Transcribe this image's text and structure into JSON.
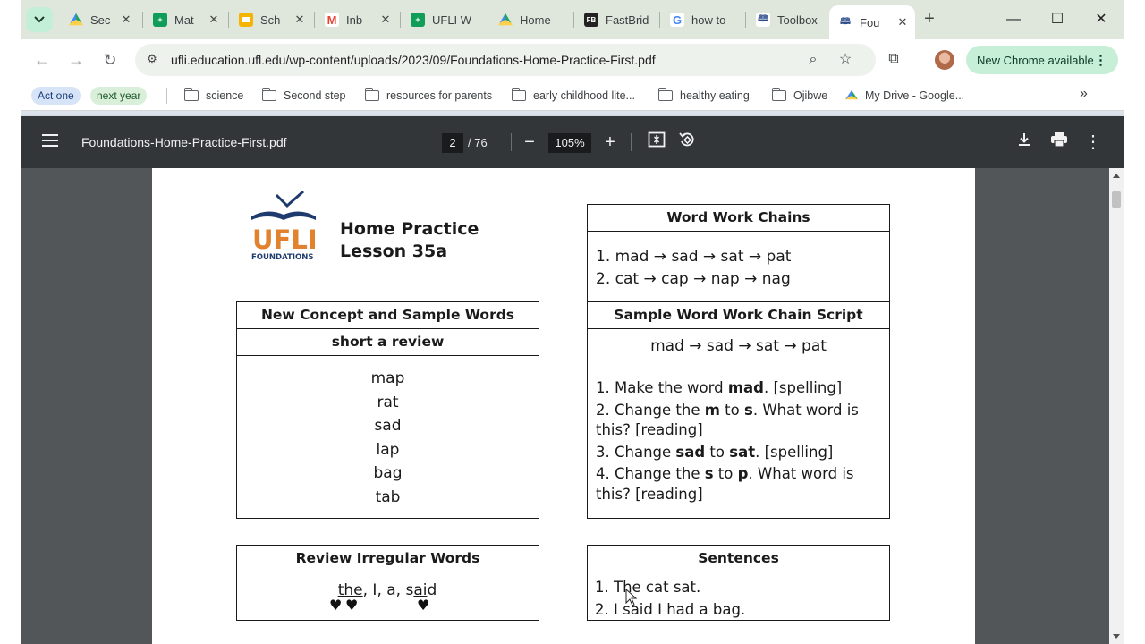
{
  "tabs": [
    {
      "title": "Sec",
      "favicon": "google-drive-icon",
      "color": "#1fa463"
    },
    {
      "title": "Mat",
      "favicon": "google-sheets-icon",
      "color": "#0f9d58"
    },
    {
      "title": "Sch",
      "favicon": "google-slides-icon",
      "color": "#f4b400"
    },
    {
      "title": "Inb",
      "favicon": "gmail-icon",
      "color": "#ea4335"
    },
    {
      "title": "UFLI W",
      "favicon": "google-sheets-icon",
      "color": "#0f9d58"
    },
    {
      "title": "Home",
      "favicon": "google-drive-icon",
      "color": "#1fa463"
    },
    {
      "title": "FastBrid",
      "favicon": "fastbridge-icon",
      "color": "#222222"
    },
    {
      "title": "how to",
      "favicon": "google-icon",
      "color": "#4285f4"
    },
    {
      "title": "Toolbox",
      "favicon": "ufli-icon",
      "color": "#2a4a8a"
    },
    {
      "title": "Fou",
      "favicon": "ufli-icon",
      "color": "#2a4a8a",
      "active": true
    }
  ],
  "window_controls": {
    "minimize": "—",
    "maximize": "☐",
    "close": "✕"
  },
  "address_bar": {
    "url": "ufli.education.ufl.edu/wp-content/uploads/2023/09/Foundations-Home-Practice-First.pdf"
  },
  "update_chip": {
    "label": "New Chrome available"
  },
  "bookmarks": {
    "chips": [
      {
        "label": "Act one",
        "style": "blue"
      },
      {
        "label": "next year",
        "style": "green"
      }
    ],
    "folders": [
      {
        "label": "science"
      },
      {
        "label": "Second step"
      },
      {
        "label": "resources for parents"
      },
      {
        "label": "early childhood lite..."
      },
      {
        "label": "healthy eating"
      },
      {
        "label": "Ojibwe"
      }
    ],
    "drive_link": "My Drive - Google...",
    "more": "»"
  },
  "pdf": {
    "filename": "Foundations-Home-Practice-First.pdf",
    "current_page": "2",
    "total_pages": "/ 76",
    "zoom": "105%"
  },
  "doc": {
    "logo": {
      "letters": "UFLI",
      "subtitle": "FOUNDATIONS"
    },
    "title_line1": "Home Practice",
    "title_line2": "Lesson 35a",
    "chains_box": {
      "header": "Word Work Chains",
      "items": [
        "1. mad → sad → sat → pat",
        "2. cat → cap → nap → nag"
      ]
    },
    "concept_box": {
      "header": "New Concept and Sample Words",
      "subheader": "short a review",
      "words": [
        "map",
        "rat",
        "sad",
        "lap",
        "bag",
        "tab"
      ]
    },
    "script_box": {
      "header": "Sample Word Work Chain Script",
      "chain": "mad → sad → sat → pat",
      "steps": {
        "s1_pre": "1. Make the word ",
        "s1_b": "mad",
        "s1_post": ". [spelling]",
        "s2_pre": "2. Change the ",
        "s2_b1": "m",
        "s2_mid": " to ",
        "s2_b2": "s",
        "s2_post": ". What word is this? [reading]",
        "s3_pre": "3. Change ",
        "s3_b1": "sad",
        "s3_mid": " to ",
        "s3_b2": "sat",
        "s3_post": ". [spelling]",
        "s4_pre": "4. Change the ",
        "s4_b1": "s",
        "s4_mid": " to ",
        "s4_b2": "p",
        "s4_post": ". What word is this? [reading]"
      }
    },
    "irregular_box": {
      "header": "Review Irregular Words",
      "w1": "the",
      "sep1": ",  ",
      "w2": "I",
      "sep2": ",  ",
      "w3": "a",
      "sep3": ",  ",
      "w4_a": "s",
      "w4_b": "ai",
      "w4_c": "d"
    },
    "sentences_box": {
      "header": "Sentences",
      "items": [
        "1. The cat sat.",
        "2. I said I had a bag."
      ]
    }
  }
}
